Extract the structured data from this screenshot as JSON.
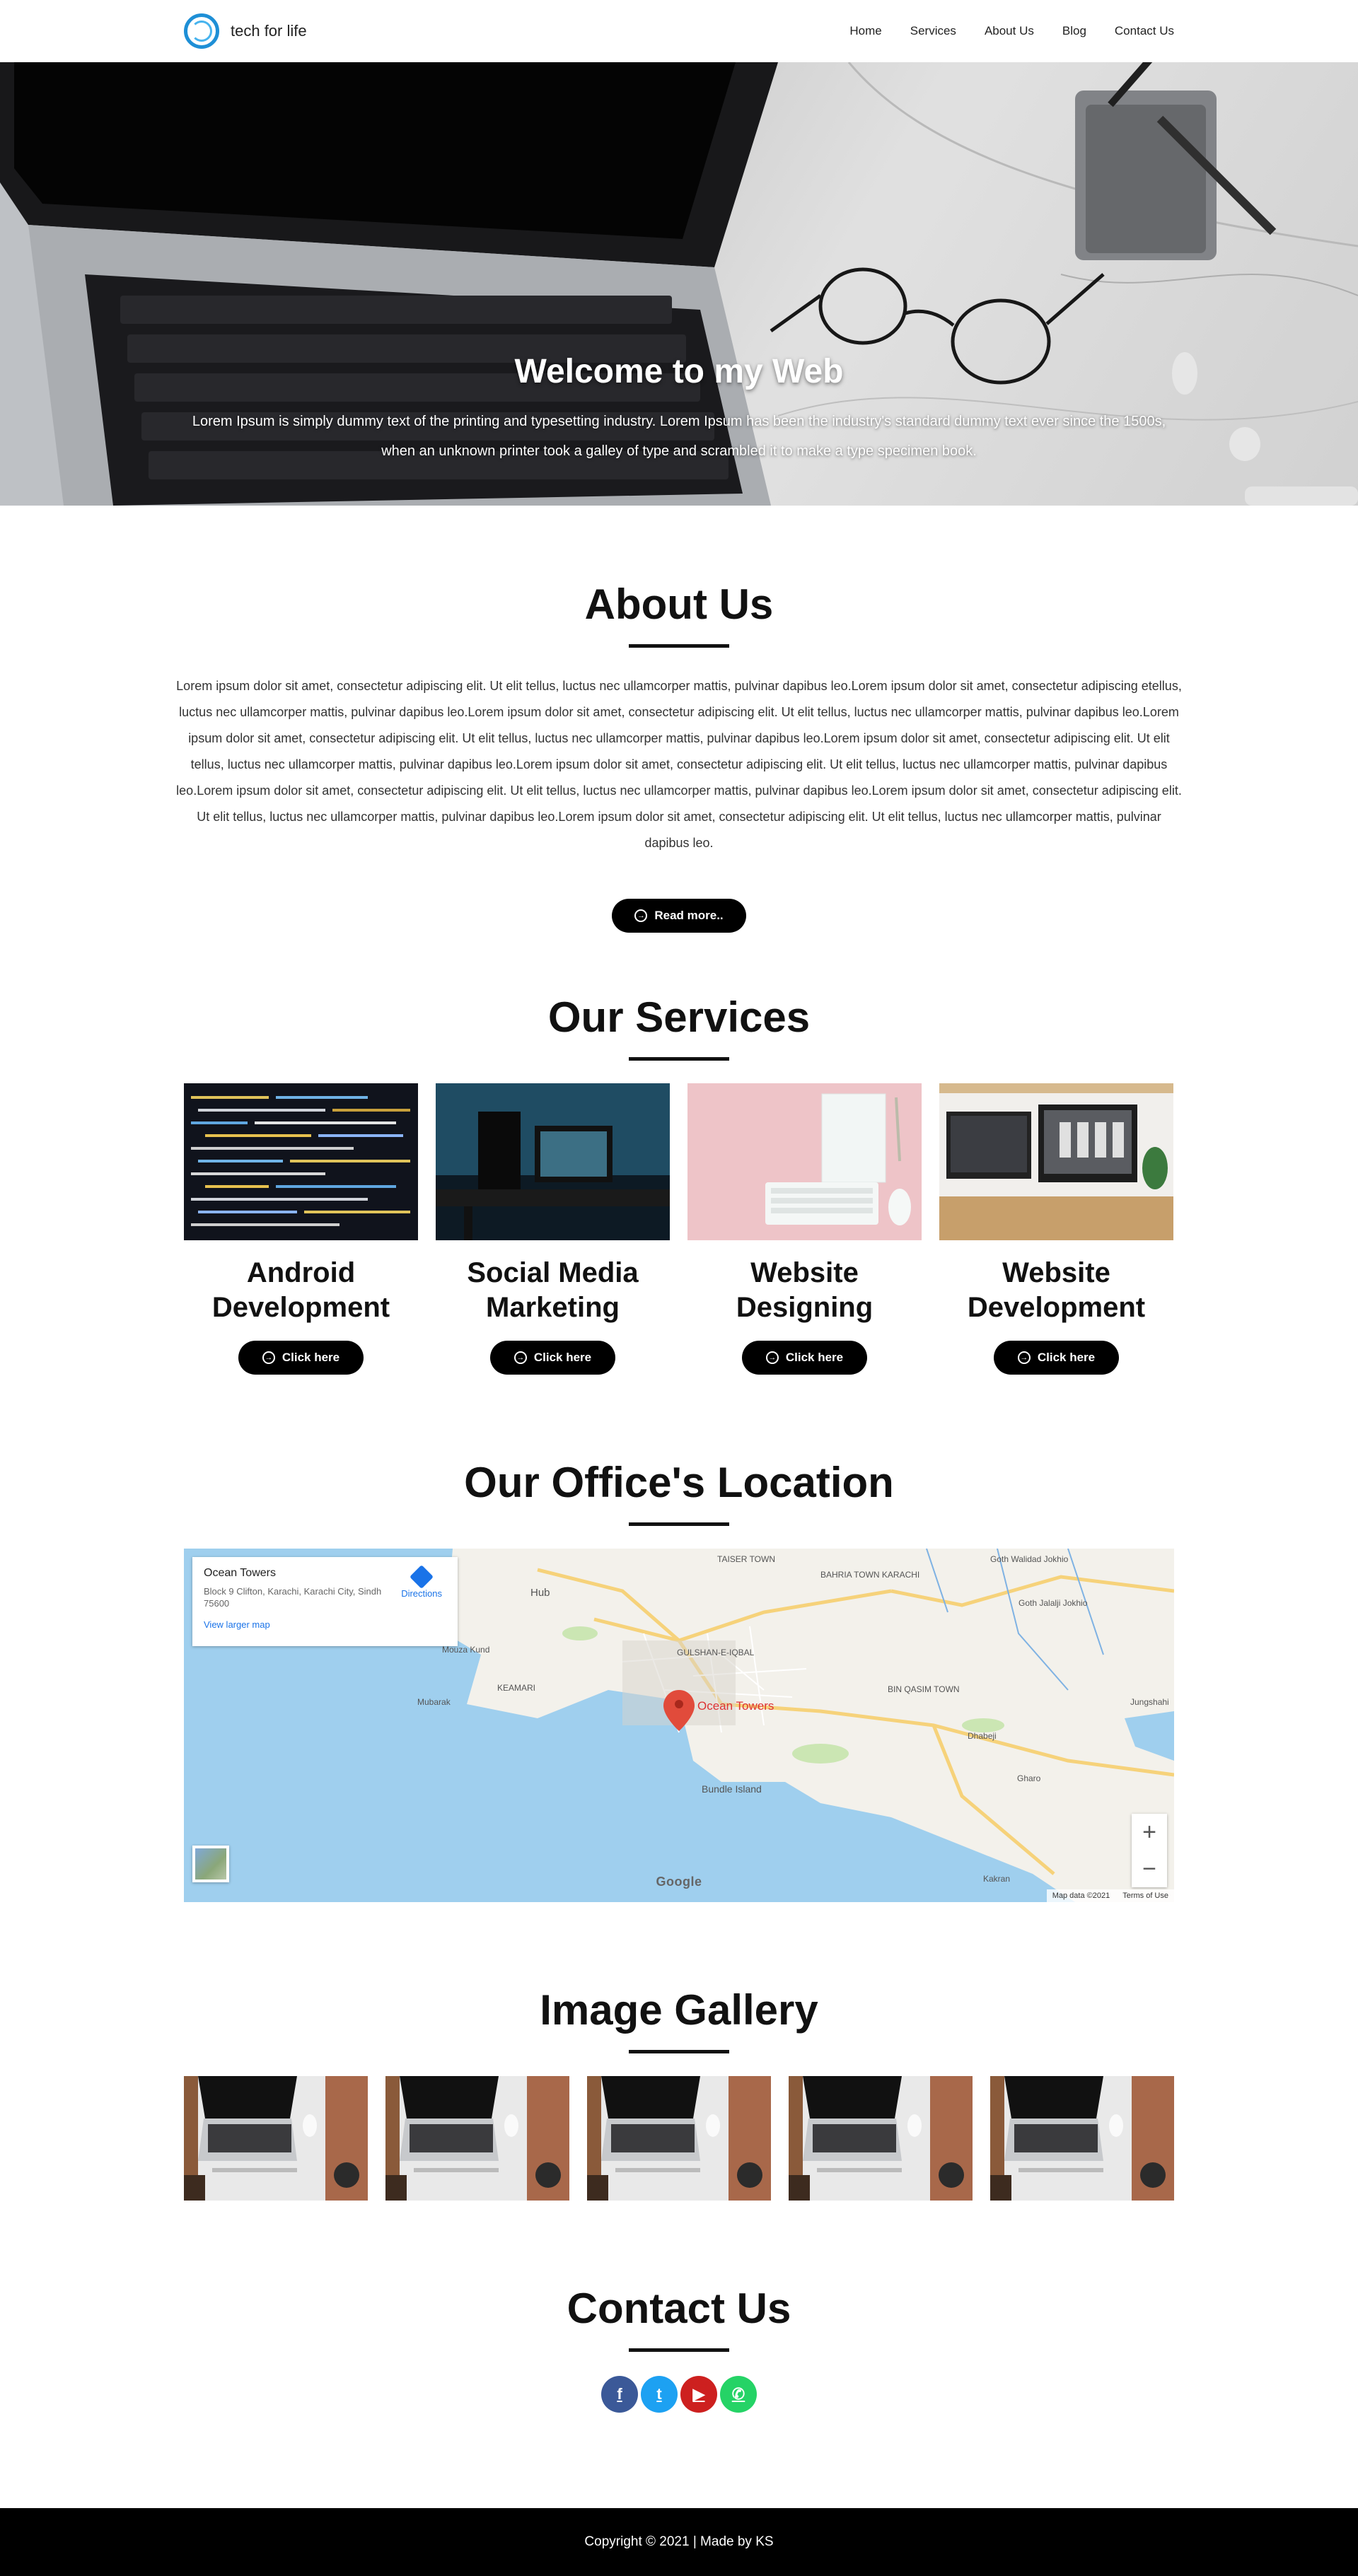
{
  "header": {
    "brand_name": "tech for life",
    "nav": [
      "Home",
      "Services",
      "About Us",
      "Blog",
      "Contact Us"
    ]
  },
  "hero": {
    "title": "Welcome to my Web",
    "subtitle": "Lorem Ipsum is simply dummy text of the printing and typesetting industry. Lorem Ipsum has been the industry's standard dummy text ever since the 1500s, when an unknown printer took a galley of type and scrambled it to make a type specimen book."
  },
  "about": {
    "title": "About Us",
    "text": "Lorem ipsum dolor sit amet, consectetur adipiscing elit. Ut elit tellus, luctus nec ullamcorper mattis, pulvinar dapibus leo.Lorem ipsum dolor sit amet, consectetur adipiscing etellus, luctus nec ullamcorper mattis, pulvinar dapibus leo.Lorem ipsum dolor sit amet, consectetur adipiscing elit. Ut elit tellus, luctus nec ullamcorper mattis, pulvinar dapibus leo.Lorem ipsum dolor sit amet, consectetur adipiscing elit. Ut elit tellus, luctus nec ullamcorper mattis, pulvinar dapibus leo.Lorem ipsum dolor sit amet, consectetur adipiscing elit. Ut elit tellus, luctus nec ullamcorper mattis, pulvinar dapibus leo.Lorem ipsum dolor sit amet, consectetur adipiscing elit. Ut elit tellus, luctus nec ullamcorper mattis, pulvinar dapibus leo.Lorem ipsum dolor sit amet, consectetur adipiscing elit. Ut elit tellus, luctus nec ullamcorper mattis, pulvinar dapibus leo.Lorem ipsum dolor sit amet, consectetur adipiscing elit. Ut elit tellus, luctus nec ullamcorper mattis, pulvinar dapibus leo.Lorem ipsum dolor sit amet, consectetur adipiscing elit. Ut elit tellus, luctus nec ullamcorper mattis, pulvinar dapibus leo.",
    "button": "Read more.."
  },
  "services": {
    "title": "Our Services",
    "items": [
      {
        "name": "Android Development",
        "button": "Click here"
      },
      {
        "name": "Social Media Marketing",
        "button": "Click here"
      },
      {
        "name": "Website Designing",
        "button": "Click here"
      },
      {
        "name": "Website Development",
        "button": "Click here"
      }
    ]
  },
  "office": {
    "title": "Our Office's Location",
    "map": {
      "place_name": "Ocean Towers",
      "address": "Block 9 Clifton, Karachi, Karachi City, Sindh 75600",
      "view_larger": "View larger map",
      "directions": "Directions",
      "pin_label": "Ocean Towers",
      "labels": [
        "TAISER TOWN",
        "BAHRIA TOWN KARACHI",
        "Goth Walidad Jokhio",
        "Hub",
        "Mouza Kund",
        "GULSHAN-E-IQBAL",
        "KEAMARI",
        "Mubarak",
        "BIN QASIM TOWN",
        "Dhabeji",
        "Bundle Island",
        "Gharo",
        "Kakran",
        "Jungshahi",
        "Goth Jalalji Jokhio"
      ],
      "map_data": "Map data ©2021",
      "terms": "Terms of Use",
      "google": "Google"
    }
  },
  "gallery": {
    "title": "Image Gallery",
    "count": 5
  },
  "contact": {
    "title": "Contact Us",
    "social": [
      {
        "icon": "facebook-icon",
        "glyph": "f",
        "color": "#3b5998"
      },
      {
        "icon": "twitter-icon",
        "glyph": "t",
        "color": "#1da1f2"
      },
      {
        "icon": "youtube-icon",
        "glyph": "▶",
        "color": "#cd201f"
      },
      {
        "icon": "whatsapp-icon",
        "glyph": "✆",
        "color": "#25d366"
      }
    ]
  },
  "footer": {
    "text": "Copyright © 2021 | Made by KS"
  }
}
